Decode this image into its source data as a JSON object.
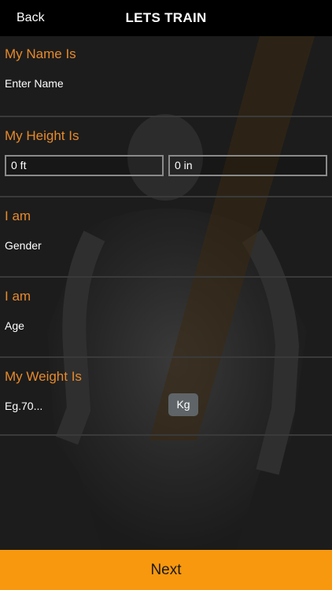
{
  "navbar": {
    "back_label": "Back",
    "title": "LETS TRAIN"
  },
  "name_section": {
    "title": "My Name Is",
    "placeholder": "Enter Name"
  },
  "height_section": {
    "title": "My Height Is",
    "feet_value": "0 ft",
    "inches_value": "0 in"
  },
  "gender_section": {
    "title": "I am",
    "placeholder": "Gender"
  },
  "age_section": {
    "title": "I am",
    "placeholder": "Age"
  },
  "weight_section": {
    "title": "My Weight Is",
    "placeholder": "Eg.70...",
    "unit_label": "Kg"
  },
  "footer": {
    "next_label": "Next"
  },
  "colors": {
    "accent": "#e68a2a",
    "next_bar": "#f7980f",
    "navbar": "#000000"
  }
}
